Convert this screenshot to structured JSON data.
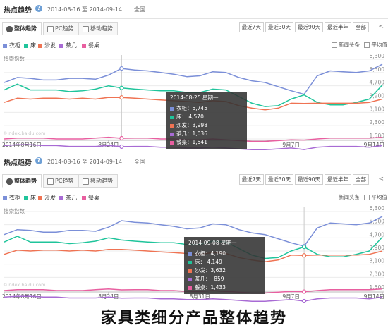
{
  "caption": "家具类细分产品整体趋势",
  "panels": [
    {
      "title": "热点趋势",
      "date_range": "2014-08-16 至 2014-09-14",
      "region": "全国",
      "tabs": [
        "整体趋势",
        "PC趋势",
        "移动趋势"
      ],
      "range_buttons": [
        "最近7天",
        "最近30天",
        "最近90天",
        "最近半年",
        "全部"
      ],
      "share": "<",
      "options": [
        "新闻头条",
        "平均值"
      ],
      "watermark": "©index.baidu.com",
      "tooltip": {
        "header": "2014-08-25 星期一",
        "rows": [
          {
            "label": "衣柜",
            "value": "5,745"
          },
          {
            "label": "床",
            "value": " 4,570"
          },
          {
            "label": "沙发",
            "value": "3,998"
          },
          {
            "label": "茶几",
            "value": "1,036"
          },
          {
            "label": "餐桌",
            "value": "1,541"
          }
        ]
      }
    },
    {
      "title": "热点趋势",
      "date_range": "2014-08-16 至 2014-09-14",
      "region": "全国",
      "tabs": [
        "整体趋势",
        "PC趋势",
        "移动趋势"
      ],
      "range_buttons": [
        "最近7天",
        "最近30天",
        "最近90天",
        "最近半年",
        "全部"
      ],
      "share": "<",
      "options": [
        "新闻头条",
        "平均值"
      ],
      "watermark": "©index.baidu.com",
      "tooltip": {
        "header": "2014-09-08 星期一",
        "rows": [
          {
            "label": "衣柜",
            "value": "4,190"
          },
          {
            "label": "床",
            "value": " 4,149"
          },
          {
            "label": "沙发",
            "value": "3,632"
          },
          {
            "label": "茶几",
            "value": "  859"
          },
          {
            "label": "餐桌",
            "value": "1,433"
          }
        ]
      }
    }
  ],
  "chart_data": [
    {
      "type": "line",
      "ylabel": "搜索指数",
      "ylim": [
        1500,
        6300
      ],
      "y_ticks": [
        "6,300",
        "5,500",
        "4,700",
        "3,900",
        "3,100",
        "2,300",
        "1,500"
      ],
      "y_tick_values": [
        6300,
        5500,
        4700,
        3900,
        3100,
        2300,
        1500
      ],
      "x_tick_labels": [
        "2014年8月16日",
        "8月24日",
        "9月7日",
        "9月14日"
      ],
      "x_tick_index": [
        0,
        8,
        22,
        29
      ],
      "highlight_index": 9,
      "x": [
        "2014-08-16",
        "2014-08-17",
        "2014-08-18",
        "2014-08-19",
        "2014-08-20",
        "2014-08-21",
        "2014-08-22",
        "2014-08-23",
        "2014-08-24",
        "2014-08-25",
        "2014-08-26",
        "2014-08-27",
        "2014-08-28",
        "2014-08-29",
        "2014-08-30",
        "2014-08-31",
        "2014-09-01",
        "2014-09-02",
        "2014-09-03",
        "2014-09-04",
        "2014-09-05",
        "2014-09-06",
        "2014-09-07",
        "2014-09-08",
        "2014-09-09",
        "2014-09-10",
        "2014-09-11",
        "2014-09-12",
        "2014-09-13",
        "2014-09-14"
      ],
      "series": [
        {
          "name": "衣柜",
          "color": "#7b8fd8",
          "values": [
            4900,
            5200,
            5150,
            5050,
            5050,
            5150,
            5150,
            5100,
            5350,
            5745,
            5650,
            5600,
            5500,
            5400,
            5250,
            5300,
            5550,
            5500,
            5200,
            5000,
            4900,
            4650,
            4400,
            4190,
            5300,
            5600,
            5550,
            5500,
            5600,
            6000
          ]
        },
        {
          "name": "床",
          "color": "#1fc49b",
          "values": [
            4450,
            4800,
            4450,
            4450,
            4450,
            4350,
            4400,
            4500,
            4700,
            4570,
            4500,
            4450,
            4400,
            4400,
            4300,
            4300,
            4500,
            4450,
            4050,
            3650,
            3450,
            3500,
            3900,
            4149,
            3700,
            3550,
            3550,
            3700,
            3900,
            4750
          ]
        },
        {
          "name": "沙发",
          "color": "#ef7353",
          "values": [
            3700,
            3950,
            3900,
            3950,
            3950,
            3900,
            3950,
            3900,
            4000,
            3998,
            3950,
            3900,
            3850,
            3800,
            3750,
            3700,
            3800,
            3750,
            3500,
            3350,
            3250,
            3350,
            3650,
            3632,
            3650,
            3650,
            3650,
            3650,
            3700,
            3900
          ]
        },
        {
          "name": "茶几",
          "color": "#a86bd4",
          "values": [
            1100,
            1150,
            1150,
            1100,
            1100,
            1050,
            1050,
            1050,
            1100,
            1036,
            1050,
            1050,
            1000,
            1000,
            950,
            950,
            1000,
            950,
            900,
            850,
            850,
            900,
            950,
            859,
            1000,
            1050,
            1050,
            1050,
            1000,
            1100
          ]
        },
        {
          "name": "餐桌",
          "color": "#e85fa0",
          "values": [
            1500,
            1550,
            1550,
            1550,
            1500,
            1500,
            1500,
            1550,
            1600,
            1541,
            1550,
            1550,
            1500,
            1500,
            1450,
            1450,
            1500,
            1450,
            1400,
            1350,
            1350,
            1400,
            1450,
            1433,
            1500,
            1550,
            1550,
            1550,
            1550,
            1600
          ]
        }
      ]
    },
    {
      "type": "line",
      "ylabel": "搜索指数",
      "ylim": [
        1500,
        6300
      ],
      "y_ticks": [
        "6,300",
        "5,500",
        "4,700",
        "3,900",
        "3,100",
        "2,300",
        "1,500"
      ],
      "y_tick_values": [
        6300,
        5500,
        4700,
        3900,
        3100,
        2300,
        1500
      ],
      "x_tick_labels": [
        "2014年8月16日",
        "8月24日",
        "8月31日",
        "9月7日",
        "9月14日"
      ],
      "x_tick_index": [
        0,
        8,
        15,
        22,
        29
      ],
      "highlight_index": 23,
      "x": [
        "2014-08-16",
        "2014-08-17",
        "2014-08-18",
        "2014-08-19",
        "2014-08-20",
        "2014-08-21",
        "2014-08-22",
        "2014-08-23",
        "2014-08-24",
        "2014-08-25",
        "2014-08-26",
        "2014-08-27",
        "2014-08-28",
        "2014-08-29",
        "2014-08-30",
        "2014-08-31",
        "2014-09-01",
        "2014-09-02",
        "2014-09-03",
        "2014-09-04",
        "2014-09-05",
        "2014-09-06",
        "2014-09-07",
        "2014-09-08",
        "2014-09-09",
        "2014-09-10",
        "2014-09-11",
        "2014-09-12",
        "2014-09-13",
        "2014-09-14"
      ],
      "series": [
        {
          "name": "衣柜",
          "color": "#7b8fd8",
          "values": [
            4900,
            5200,
            5150,
            5050,
            5050,
            5150,
            5150,
            5100,
            5350,
            5745,
            5650,
            5600,
            5500,
            5400,
            5250,
            5300,
            5550,
            5500,
            5200,
            5000,
            4900,
            4650,
            4400,
            4190,
            5300,
            5600,
            5550,
            5500,
            5600,
            6000
          ]
        },
        {
          "name": "床",
          "color": "#1fc49b",
          "values": [
            4450,
            4800,
            4450,
            4450,
            4450,
            4350,
            4400,
            4500,
            4700,
            4570,
            4500,
            4450,
            4400,
            4400,
            4300,
            4300,
            4500,
            4450,
            4050,
            3650,
            3450,
            3500,
            3900,
            4149,
            3700,
            3550,
            3550,
            3700,
            3900,
            4750
          ]
        },
        {
          "name": "沙发",
          "color": "#ef7353",
          "values": [
            3700,
            3950,
            3900,
            3950,
            3950,
            3900,
            3950,
            3900,
            4000,
            3998,
            3950,
            3900,
            3850,
            3800,
            3750,
            3700,
            3800,
            3750,
            3500,
            3350,
            3250,
            3350,
            3650,
            3632,
            3650,
            3650,
            3650,
            3650,
            3700,
            3900
          ]
        },
        {
          "name": "茶几",
          "color": "#a86bd4",
          "values": [
            1100,
            1150,
            1150,
            1100,
            1100,
            1050,
            1050,
            1050,
            1100,
            1036,
            1050,
            1050,
            1000,
            1000,
            950,
            950,
            1000,
            950,
            900,
            850,
            850,
            900,
            950,
            859,
            1000,
            1050,
            1050,
            1050,
            1000,
            1100
          ]
        },
        {
          "name": "餐桌",
          "color": "#e85fa0",
          "values": [
            1500,
            1550,
            1550,
            1550,
            1500,
            1500,
            1500,
            1550,
            1600,
            1541,
            1550,
            1550,
            1500,
            1500,
            1450,
            1450,
            1500,
            1450,
            1400,
            1350,
            1350,
            1400,
            1450,
            1433,
            1500,
            1550,
            1550,
            1550,
            1550,
            1600
          ]
        }
      ]
    }
  ]
}
